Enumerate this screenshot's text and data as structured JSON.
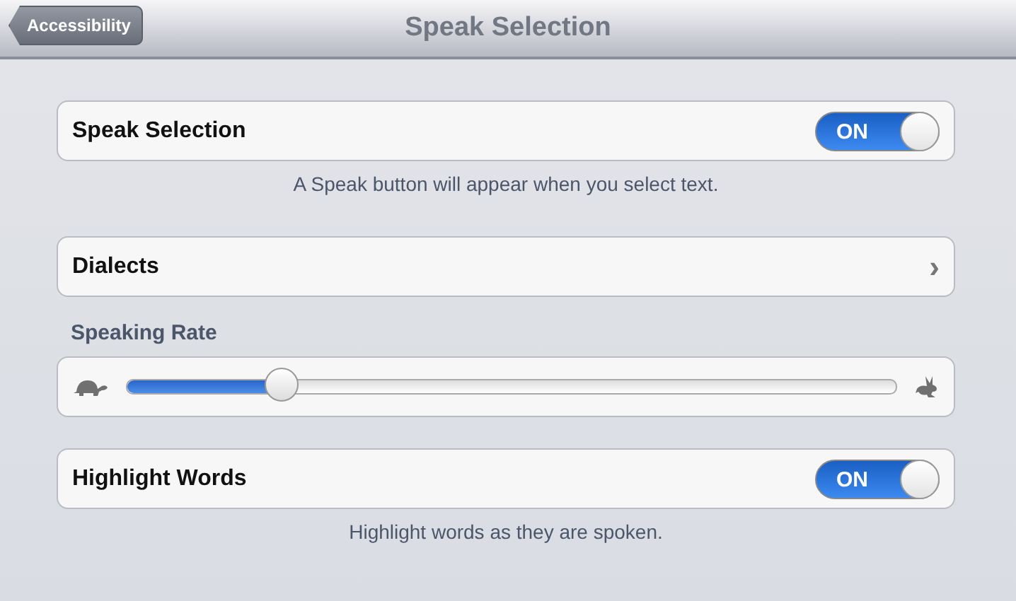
{
  "nav_bar": {
    "back_button": "Accessibility",
    "title": "Speak Selection"
  },
  "groups": [
    {
      "kind": "toggle",
      "label": "Speak Selection",
      "on_label": "ON",
      "on": true,
      "footer": "A Speak button will appear when you select text."
    },
    {
      "kind": "disclosure",
      "label": "Dialects",
      "chevron": "›"
    },
    {
      "kind": "slider",
      "header": "Speaking Rate",
      "level": 0.2
    },
    {
      "kind": "toggle",
      "label": "Highlight Words",
      "on_label": "ON",
      "on": true,
      "footer": "Highlight words as they are spoken."
    }
  ]
}
